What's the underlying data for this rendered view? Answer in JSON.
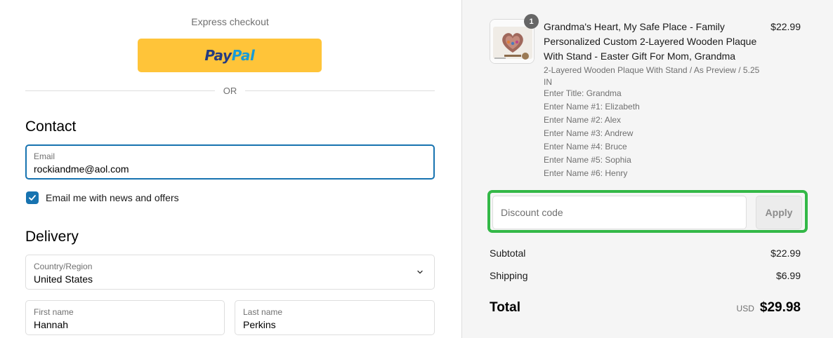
{
  "express": {
    "label": "Express checkout",
    "paypal_pay": "Pay",
    "paypal_pal": "Pal"
  },
  "divider": {
    "or": "OR"
  },
  "contact": {
    "heading": "Contact",
    "email_label": "Email",
    "email_value": "rockiandme@aol.com",
    "newsletter_label": "Email me with news and offers",
    "newsletter_checked": true
  },
  "delivery": {
    "heading": "Delivery",
    "country_label": "Country/Region",
    "country_value": "United States",
    "first_name_label": "First name",
    "first_name_value": "Hannah",
    "last_name_label": "Last name",
    "last_name_value": "Perkins"
  },
  "order": {
    "item": {
      "quantity": "1",
      "title": "Grandma's Heart, My Safe Place - Family Personalized Custom 2-Layered Wooden Plaque With Stand - Easter Gift For Mom, Grandma",
      "price": "$22.99",
      "variant": "2-Layered Wooden Plaque With Stand / As Preview / 5.25 IN",
      "properties": [
        "Enter Title: Grandma",
        "Enter Name #1: Elizabeth",
        "Enter Name #2: Alex",
        "Enter Name #3: Andrew",
        "Enter Name #4: Bruce",
        "Enter Name #5: Sophia",
        "Enter Name #6: Henry"
      ]
    },
    "discount": {
      "placeholder": "Discount code",
      "apply_label": "Apply",
      "highlight_color": "#33b847"
    },
    "summary": {
      "subtotal_label": "Subtotal",
      "subtotal_value": "$22.99",
      "shipping_label": "Shipping",
      "shipping_value": "$6.99",
      "total_label": "Total",
      "currency": "USD",
      "total_value": "$29.98"
    }
  },
  "colors": {
    "accent": "#1773b0",
    "paypal_yellow": "#ffc439",
    "paypal_dark_blue": "#253b80",
    "paypal_light_blue": "#179bd7",
    "summary_bg": "#f5f5f5"
  },
  "icons": {
    "checkbox": "checkmark-icon",
    "country_select": "chevron-down-icon",
    "thumbnail": "product-thumbnail"
  }
}
